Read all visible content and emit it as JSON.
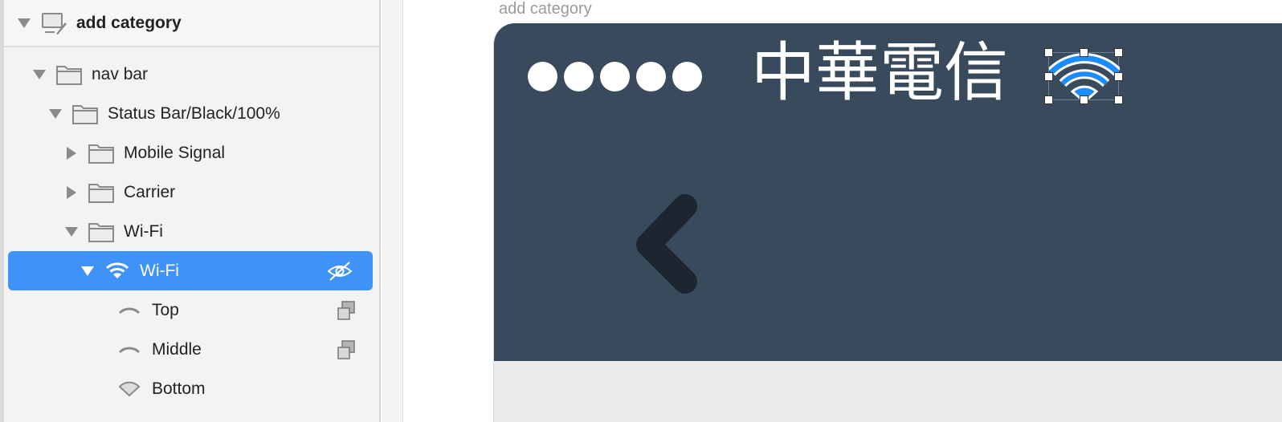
{
  "layers": {
    "page": {
      "label": "add category",
      "icon": "artboard-icon",
      "expanded": true
    },
    "items": [
      {
        "label": "nav bar",
        "icon": "folder-icon",
        "expanded": true
      },
      {
        "label": "Status Bar/Black/100%",
        "icon": "folder-icon",
        "expanded": true
      },
      {
        "label": "Mobile Signal",
        "icon": "folder-icon",
        "expanded": false
      },
      {
        "label": "Carrier",
        "icon": "folder-icon",
        "expanded": false
      },
      {
        "label": "Wi-Fi",
        "icon": "folder-icon",
        "expanded": true
      },
      {
        "label": "Wi-Fi",
        "icon": "wifi-icon",
        "expanded": true,
        "selected": true,
        "right_icon": "hidden-eye-icon"
      },
      {
        "label": "Top",
        "icon": "arc-shape-icon",
        "right_icon": "mask-icon"
      },
      {
        "label": "Middle",
        "icon": "arc-shape-icon",
        "right_icon": "mask-icon"
      },
      {
        "label": "Bottom",
        "icon": "wedge-shape-icon"
      }
    ]
  },
  "canvas": {
    "artboard_label": "add category",
    "status_bar": {
      "carrier": "中華電信",
      "signal_dots": 5
    },
    "colors": {
      "navbar": "#394a5d",
      "selection": "#3f92f7",
      "wifi": "#1a8cff",
      "artboard_bg": "#ebebeb",
      "chevron": "#1c2530"
    }
  }
}
